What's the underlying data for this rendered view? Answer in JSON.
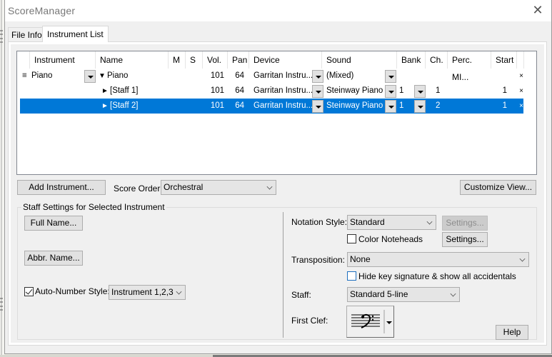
{
  "window": {
    "title": "ScoreManager",
    "close_icon": "close-icon"
  },
  "tabs": [
    {
      "label": "File Info",
      "active": false
    },
    {
      "label": "Instrument List",
      "active": true
    }
  ],
  "instrument_list": {
    "columns": [
      "Instrument",
      "Name",
      "M",
      "S",
      "Vol.",
      "Pan",
      "Device",
      "Sound",
      "Bank",
      "Ch.",
      "Perc. MI...",
      "Start"
    ],
    "rows": [
      {
        "handle": "≡",
        "instrument": "Piano",
        "name_expander": "▼",
        "name": "Piano",
        "vol": "101",
        "pan": "64",
        "device": "Garritan Instru...",
        "sound": "(Mixed)",
        "bank": "",
        "channel": "",
        "perc_mi": "",
        "start": "",
        "delete": "×",
        "selected": false,
        "level": 0
      },
      {
        "handle": "",
        "instrument": "",
        "name_expander": "►",
        "name": "[Staff 1]",
        "vol": "101",
        "pan": "64",
        "device": "Garritan Instru...",
        "sound": "Steinway Piano",
        "bank": "1",
        "channel": "1",
        "perc_mi": "",
        "start": "1",
        "delete": "×",
        "selected": false,
        "level": 1
      },
      {
        "handle": "",
        "instrument": "",
        "name_expander": "►",
        "name": "[Staff 2]",
        "vol": "101",
        "pan": "64",
        "device": "Garritan Instru...",
        "sound": "Steinway Piano",
        "bank": "1",
        "channel": "2",
        "perc_mi": "",
        "start": "1",
        "delete": "×",
        "selected": true,
        "level": 1
      }
    ]
  },
  "toolbar": {
    "add_instrument": "Add Instrument...",
    "score_order_label": "Score Order:",
    "score_order_value": "Orchestral",
    "customize_view": "Customize View..."
  },
  "staff_settings": {
    "group_title": "Staff Settings for Selected Instrument",
    "full_name": "Full Name...",
    "abbr_name": "Abbr. Name...",
    "auto_number_label": "Auto-Number Style:",
    "auto_number_checked": true,
    "auto_number_value": "Instrument 1,2,3",
    "notation_style_label": "Notation Style:",
    "notation_style_value": "Standard",
    "notation_settings": "Settings...",
    "notation_settings_enabled": false,
    "color_noteheads_label": "Color Noteheads",
    "color_noteheads_checked": false,
    "color_settings": "Settings...",
    "transposition_label": "Transposition:",
    "transposition_value": "None",
    "hide_key_label": "Hide key signature & show all accidentals",
    "hide_key_checked": false,
    "staff_label": "Staff:",
    "staff_value": "Standard 5-line",
    "first_clef_label": "First Clef:",
    "first_clef_value": "bass-clef",
    "help": "Help"
  },
  "colors": {
    "selection": "#0078d7",
    "window_bg": "#f0f0f0"
  }
}
